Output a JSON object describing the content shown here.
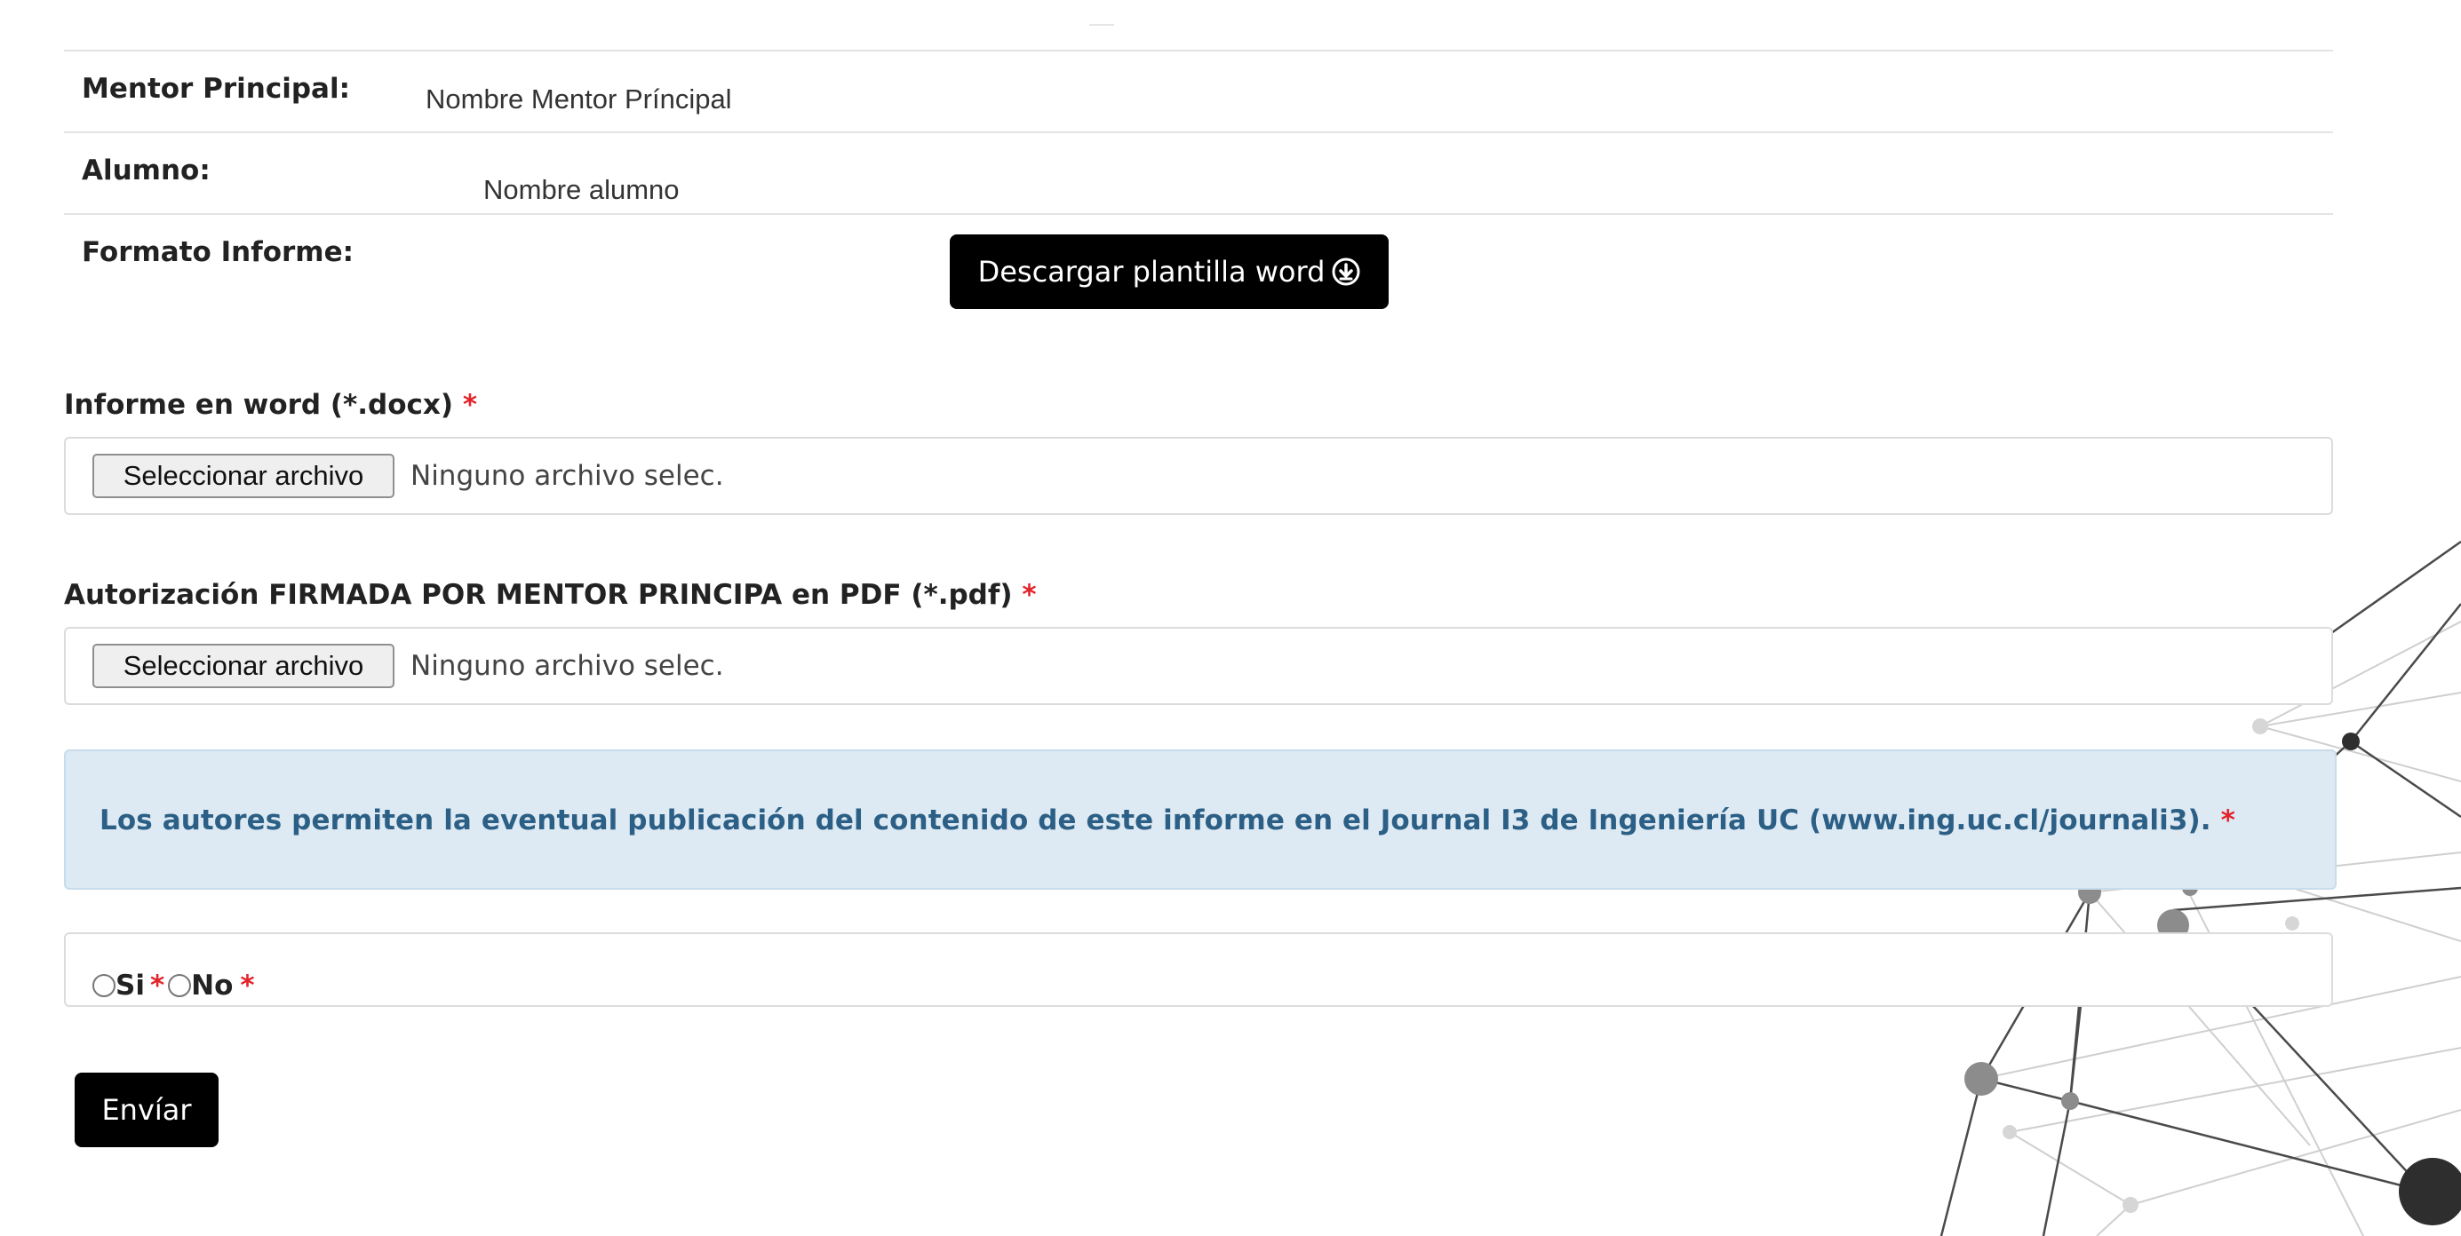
{
  "report_info": {
    "mentor_label": "Mentor Principal:",
    "mentor_value": "Nombre Mentor Príncipal",
    "student_label": "Alumno:",
    "student_value": "Nombre alumno",
    "format_label": "Formato Informe:",
    "download_button": "Descargar plantilla word",
    "download_icon": "download-circle-icon"
  },
  "upload_word": {
    "label": "Informe en word (*.docx)",
    "required_mark": "*",
    "button_label": "Seleccionar archivo",
    "status": "Ninguno archivo selec."
  },
  "upload_pdf": {
    "label": "Autorización FIRMADA POR MENTOR PRINCIPA en PDF (*.pdf)",
    "required_mark": "*",
    "button_label": "Seleccionar archivo",
    "status": "Ninguno archivo selec."
  },
  "consent": {
    "text": "Los autores permiten la eventual publicación del contenido de este informe en el Journal I3 de Ingeniería UC (www.ing.uc.cl/journali3).",
    "required_mark": "*"
  },
  "publication_choice": {
    "yes_label": "Si",
    "no_label": "No",
    "required_mark": "*"
  },
  "submit_button": "Envíar",
  "colors": {
    "required": "#e3242b",
    "consent_bg": "#dde9f3",
    "consent_text": "#2b5f85",
    "button_bg": "#000000"
  }
}
